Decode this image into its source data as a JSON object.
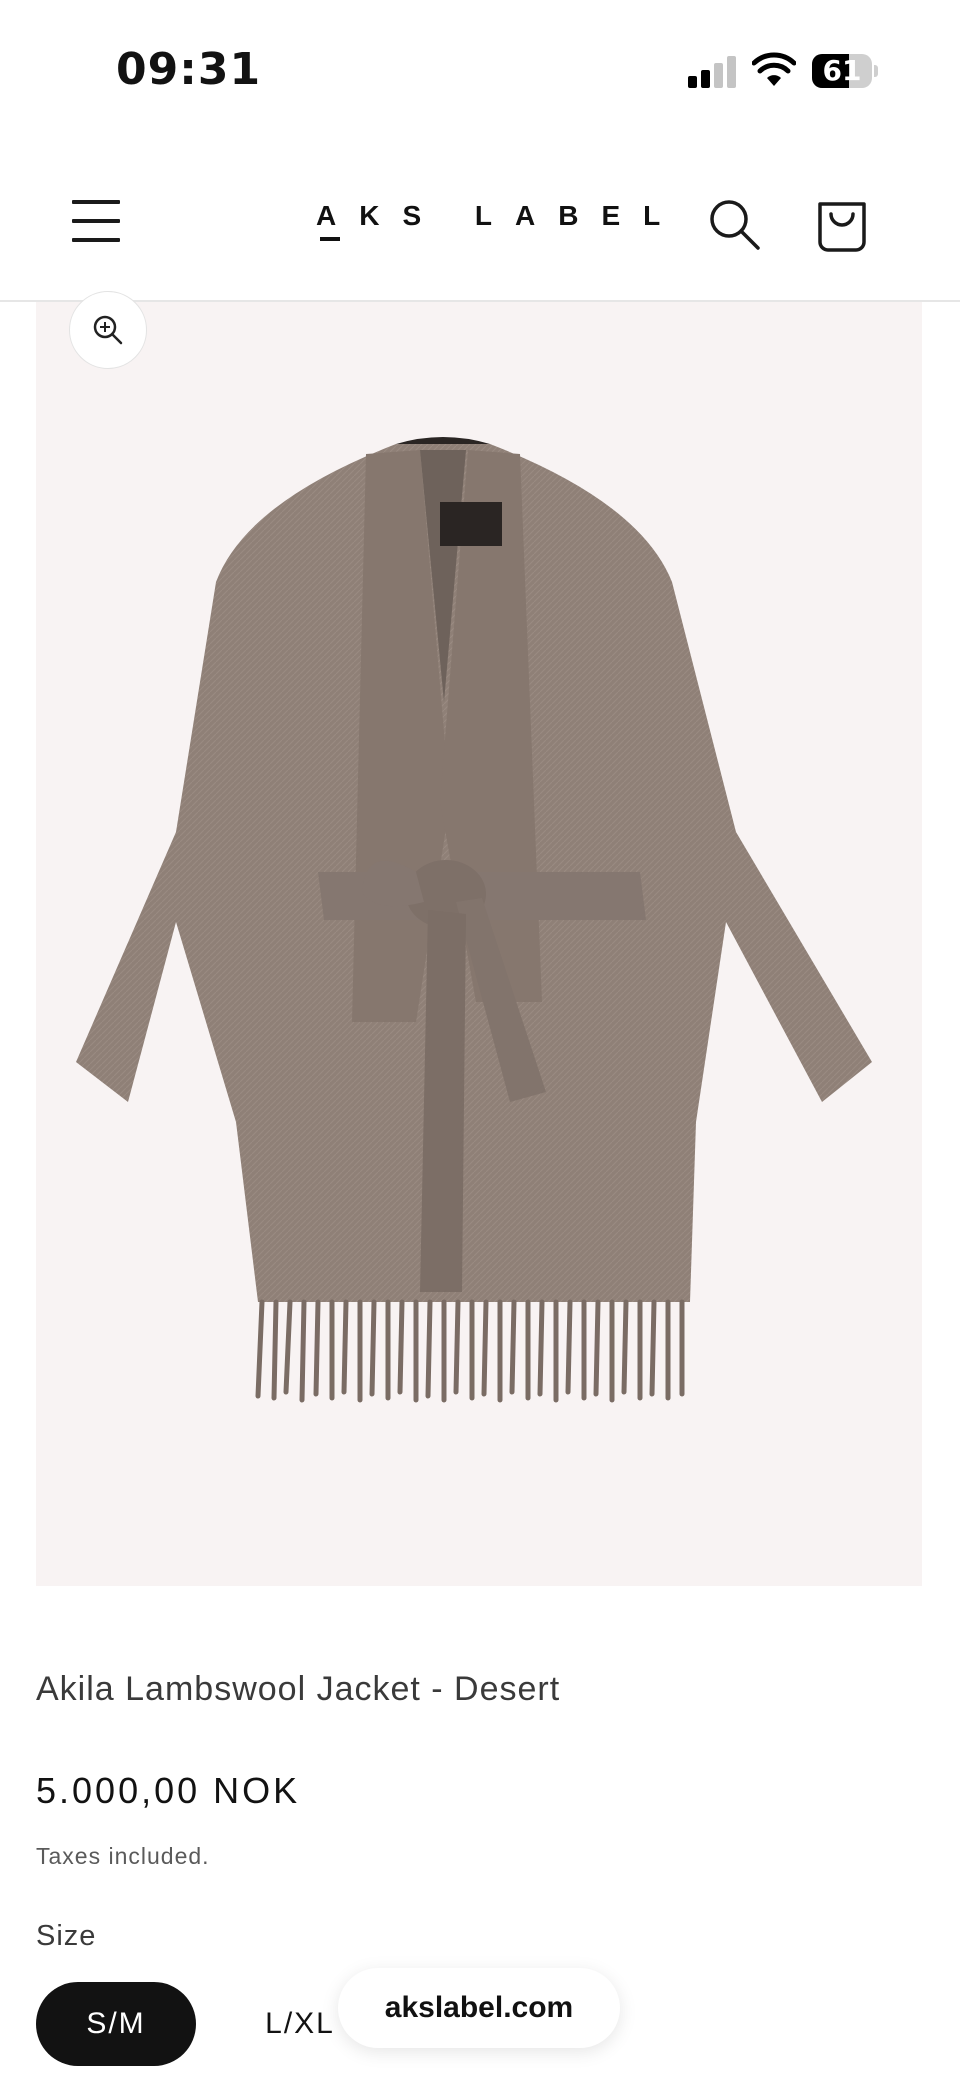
{
  "status_bar": {
    "time": "09:31",
    "battery_level": 61,
    "battery_label": "61",
    "signal_icon": "cellular-signal-icon",
    "wifi_icon": "wifi-icon"
  },
  "header": {
    "logo": "AKS LABEL",
    "menu_icon": "hamburger-menu-icon",
    "search_icon": "search-icon",
    "cart_icon": "shopping-bag-icon"
  },
  "product": {
    "image_alt": "Belted wool kimono jacket with fringe hem",
    "zoom_icon": "zoom-in-icon",
    "title": "Akila Lambswool Jacket - Desert",
    "price": "5.000,00 NOK",
    "tax_note": "Taxes included.",
    "size_label": "Size",
    "sizes": [
      {
        "label": "S/M",
        "selected": true
      },
      {
        "label": "L/XL",
        "selected": false
      }
    ]
  },
  "browser": {
    "url": "akslabel.com"
  },
  "colors": {
    "accent": "#121212",
    "image_bg": "#f8f3f3",
    "jacket": "#8f8077"
  }
}
